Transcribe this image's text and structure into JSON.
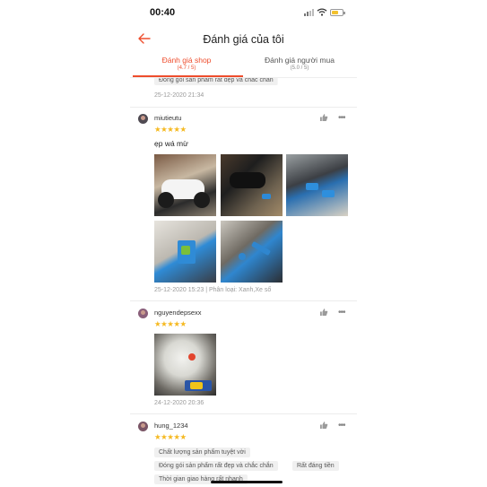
{
  "status_bar": {
    "time": "00:40"
  },
  "header": {
    "title": "Đánh giá của tôi"
  },
  "tabs": [
    {
      "label": "Đánh giá shop",
      "count": "(4.7 / 5)",
      "active": true
    },
    {
      "label": "Đánh giá người mua",
      "count": "(5.0 / 5)",
      "active": false
    }
  ],
  "top_fragment": {
    "tag": "Đóng gói sản phẩm rất đẹp và chắc chắn",
    "date": "25-12-2020 21:34"
  },
  "reviews": [
    {
      "username": "miutieutu",
      "rating": 5,
      "comment": "ẹp wá mừ",
      "photos": 5,
      "meta": "25-12-2020 15:23 | Phân loại: Xanh,Xe số"
    },
    {
      "username": "nguyendepsexx",
      "rating": 5,
      "photos": 1,
      "meta": "24-12-2020 20:36"
    },
    {
      "username": "hung_1234",
      "rating": 5,
      "tags": [
        "Chất lượng sản phẩm tuyệt vời",
        "Đóng gói sản phẩm rất đẹp và chắc chắn",
        "Rất đáng tiền",
        "Thời gian giao hàng rất nhanh"
      ]
    }
  ],
  "icons": {
    "back": "back-arrow-icon",
    "like": "thumbs-up-icon",
    "more": "more-dots-icon",
    "star": "star-icon"
  },
  "colors": {
    "accent": "#ee4d2d",
    "star": "#f5b921"
  }
}
